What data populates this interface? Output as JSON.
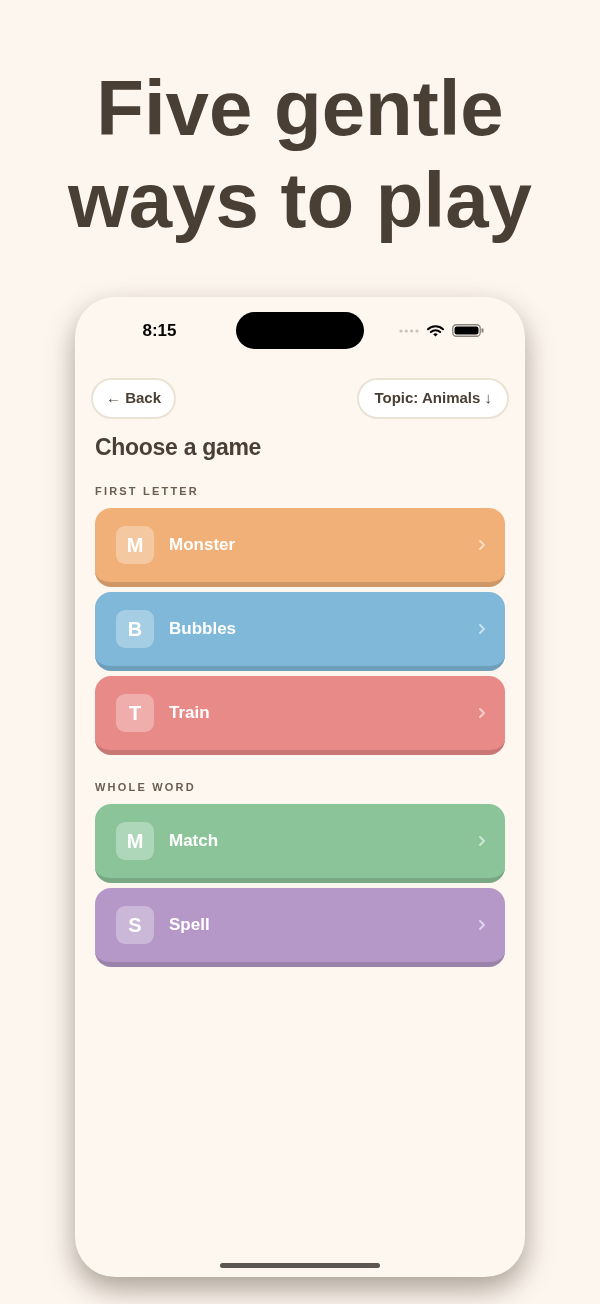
{
  "headline": "Five gentle ways to play",
  "status_bar": {
    "time": "8:15"
  },
  "nav": {
    "back": "← Back",
    "topic": "Topic: Animals ↓"
  },
  "title": "Choose a game",
  "sections": [
    {
      "heading": "FIRST LETTER",
      "games": [
        {
          "letter": "M",
          "name": "Monster",
          "color": "#f0b077"
        },
        {
          "letter": "B",
          "name": "Bubbles",
          "color": "#7fb8d8"
        },
        {
          "letter": "T",
          "name": "Train",
          "color": "#e88a88"
        }
      ]
    },
    {
      "heading": "WHOLE WORD",
      "games": [
        {
          "letter": "M",
          "name": "Match",
          "color": "#8cc49a"
        },
        {
          "letter": "S",
          "name": "Spell",
          "color": "#b598c7"
        }
      ]
    }
  ]
}
